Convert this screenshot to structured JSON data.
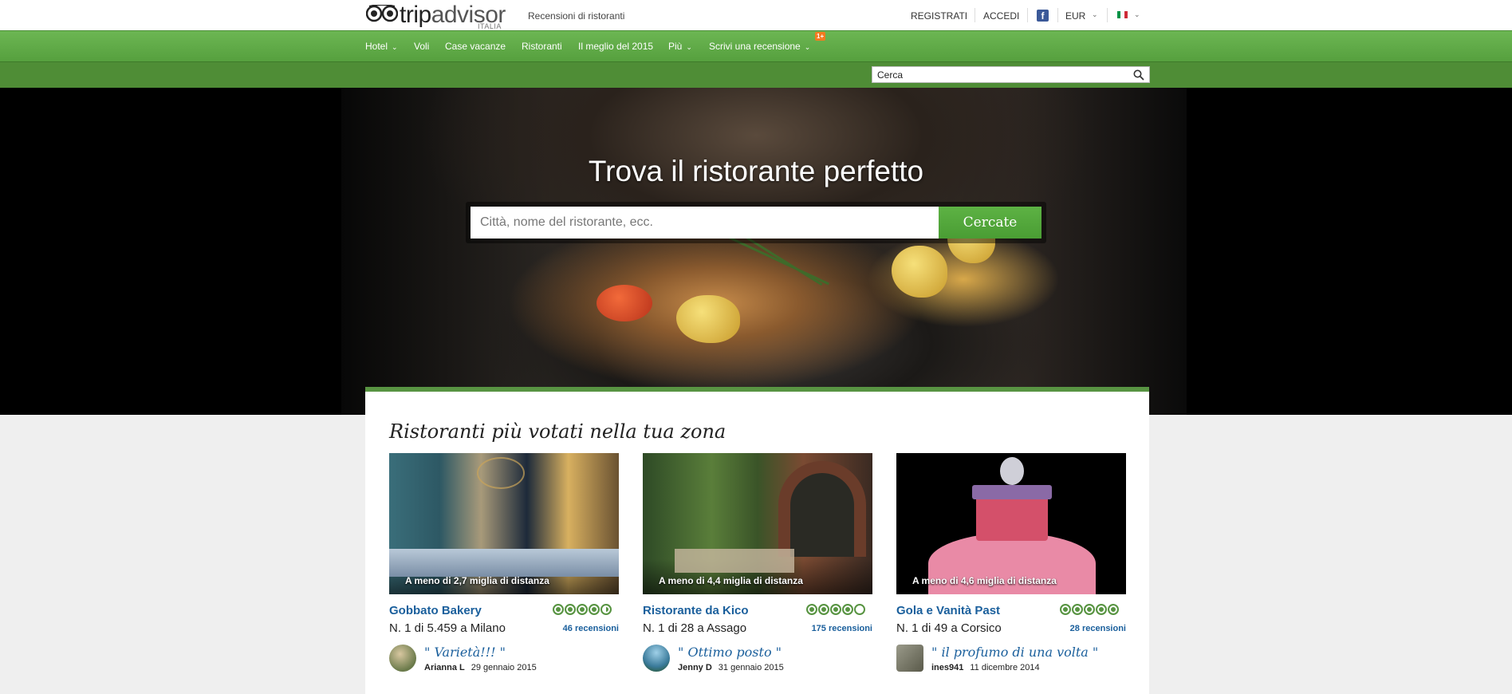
{
  "brand": {
    "name_trip": "trip",
    "name_advisor": "advisor",
    "country": "ITALIA",
    "tagline": "Recensioni di ristoranti"
  },
  "toplinks": {
    "register": "REGISTRATI",
    "login": "ACCEDI",
    "facebook_icon": "facebook-icon",
    "currency": "EUR",
    "language_icon": "italy-flag-icon"
  },
  "nav": {
    "items": [
      {
        "label": "Hotel",
        "dropdown": true
      },
      {
        "label": "Voli",
        "dropdown": false
      },
      {
        "label": "Case vacanze",
        "dropdown": false
      },
      {
        "label": "Ristoranti",
        "dropdown": false
      },
      {
        "label": "Il meglio del 2015",
        "dropdown": false
      },
      {
        "label": "Più",
        "dropdown": true
      },
      {
        "label": "Scrivi una recensione",
        "dropdown": true
      }
    ],
    "badge": "1+"
  },
  "search_top": {
    "placeholder": "Cerca"
  },
  "hero": {
    "title": "Trova il ristorante perfetto",
    "search_placeholder": "Città, nome del ristorante, ecc.",
    "button_label": "Cercate"
  },
  "section": {
    "title": "Ristoranti più votati nella tua zona",
    "cards": [
      {
        "distance": "A meno di 2,7 miglia di distanza",
        "name": "Gobbato Bakery",
        "rank": "N. 1 di 5.459 a Milano",
        "rating": 4.5,
        "reviews": "46 recensioni",
        "quote": "\" Varietà!!! \"",
        "author": "Arianna L",
        "date": "29 gennaio 2015"
      },
      {
        "distance": "A meno di 4,4 miglia di distanza",
        "name": "Ristorante da Kico",
        "rank": "N. 1 di 28 a Assago",
        "rating": 4,
        "reviews": "175 recensioni",
        "quote": "\" Ottimo posto \"",
        "author": "Jenny D",
        "date": "31 gennaio 2015"
      },
      {
        "distance": "A meno di 4,6 miglia di distanza",
        "name": "Gola e Vanità Past",
        "rank": "N. 1 di 49 a Corsico",
        "rating": 5,
        "reviews": "28 recensioni",
        "quote": "\" il profumo di una volta \"",
        "author": "ines941",
        "date": "11 dicembre 2014"
      }
    ]
  },
  "colors": {
    "green": "#589442",
    "nav_green": "#6cb653",
    "link_blue": "#1a5f9c",
    "badge_orange": "#f37a1f"
  }
}
